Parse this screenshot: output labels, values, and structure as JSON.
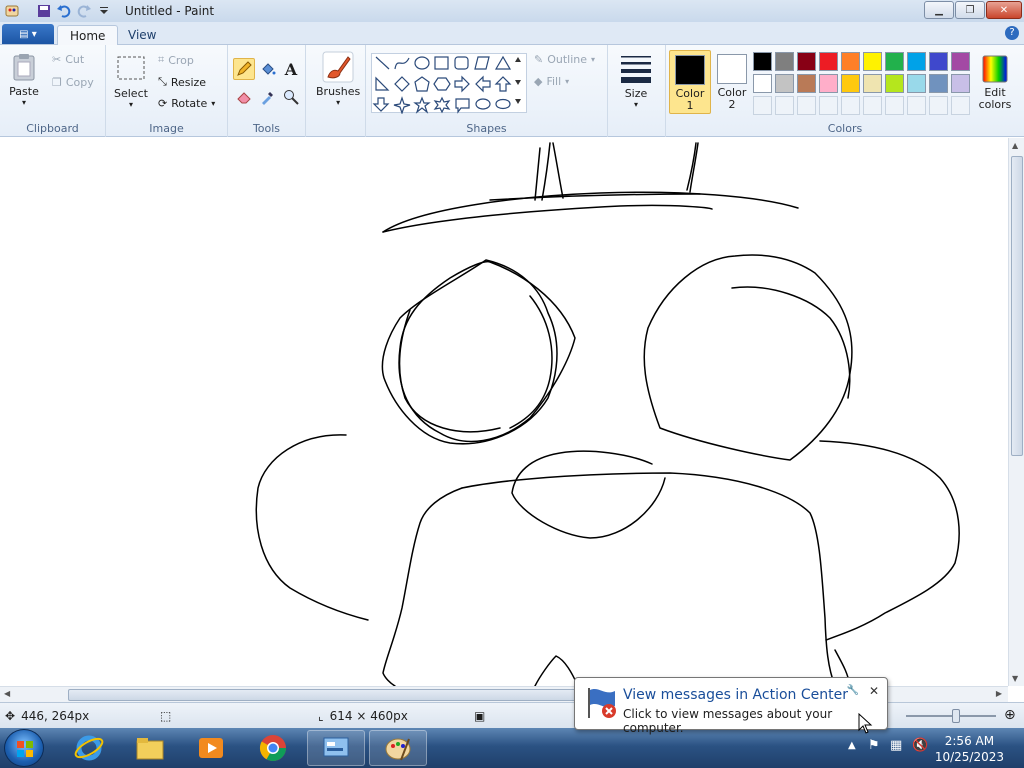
{
  "window": {
    "title": "Untitled - Paint"
  },
  "tabs": {
    "home": "Home",
    "view": "View"
  },
  "clipboard": {
    "paste": "Paste",
    "cut": "Cut",
    "copy": "Copy",
    "label": "Clipboard"
  },
  "image": {
    "select": "Select",
    "crop": "Crop",
    "resize": "Resize",
    "rotate": "Rotate",
    "label": "Image"
  },
  "tools": {
    "label": "Tools"
  },
  "brushes": {
    "label": "Brushes"
  },
  "shapes": {
    "outline": "Outline",
    "fill": "Fill",
    "label": "Shapes"
  },
  "size": {
    "label": "Size"
  },
  "colors": {
    "color1_label": "Color 1",
    "color1_value": "#000000",
    "color2_label": "Color 2",
    "color2_value": "#ffffff",
    "edit": "Edit colors",
    "label": "Colors",
    "palette": [
      "#000000",
      "#7f7f7f",
      "#880015",
      "#ed1c24",
      "#ff7f27",
      "#fff200",
      "#22b14c",
      "#00a2e8",
      "#3f48cc",
      "#a349a4",
      "#ffffff",
      "#c3c3c3",
      "#b97a57",
      "#ffaec9",
      "#ffc90e",
      "#efe4b0",
      "#b5e61d",
      "#99d9ea",
      "#7092be",
      "#c8bfe7"
    ]
  },
  "status": {
    "cursor_pos": "446, 264px",
    "image_size": "614 × 460px"
  },
  "balloon": {
    "title": "View messages in Action Center",
    "body": "Click to view messages about your computer."
  },
  "taskbar": {
    "time": "2:56 AM",
    "date": "10/25/2023",
    "apps": [
      "internet-explorer-icon",
      "file-explorer-icon",
      "media-player-icon",
      "chrome-icon",
      "control-panel-icon",
      "paint-icon"
    ]
  }
}
